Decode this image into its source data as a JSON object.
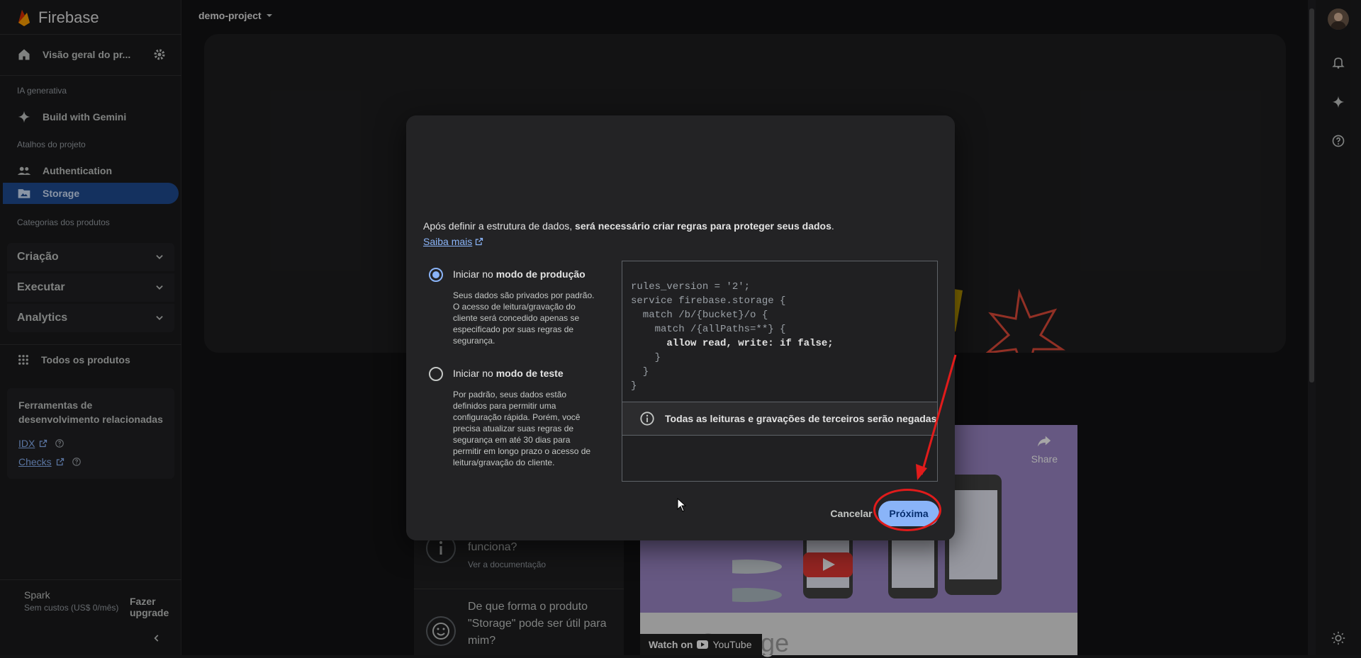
{
  "brand": {
    "name": "Firebase"
  },
  "project": {
    "name": "demo-project"
  },
  "sidebar": {
    "overview_label": "Visão geral do pr...",
    "section_ai": "IA generativa",
    "gemini_label": "Build with Gemini",
    "section_shortcuts": "Atalhos do projeto",
    "auth_label": "Authentication",
    "storage_label": "Storage",
    "section_categories": "Categorias dos produtos",
    "groups": [
      "Criação",
      "Executar",
      "Analytics"
    ],
    "all_products": "Todos os produtos",
    "devtools_title": "Ferramentas de desenvolvimento relacionadas",
    "devtools_links": [
      "IDX",
      "Checks"
    ],
    "plan_name": "Spark",
    "plan_cost": "Sem custos (US$ 0/mês)",
    "upgrade": "Fazer upgrade"
  },
  "background": {
    "card1_title": "funciona?",
    "card1_link": "Ver a documentação",
    "card2_title": "De que forma o produto \"Storage\" pode ser útil para mim?",
    "video_share": "Share",
    "video_watch": "Watch on",
    "video_brand": "YouTube",
    "video_title": "Storage"
  },
  "modal": {
    "intro_text": "Após definir a estrutura de dados, ",
    "intro_bold": "será necessário criar regras para proteger seus dados",
    "intro_end": ".",
    "learn_more": "Saiba mais",
    "option_prod": {
      "prefix": "Iniciar no ",
      "bold": "modo de produção",
      "selected": true,
      "desc": "Seus dados são privados por padrão. O acesso de leitura/gravação do cliente será concedido apenas se especificado por suas regras de segurança."
    },
    "option_test": {
      "prefix": "Iniciar no ",
      "bold": "modo de teste",
      "selected": false,
      "desc": "Por padrão, seus dados estão definidos para permitir uma configuração rápida. Porém, você precisa atualizar suas regras de segurança em até 30 dias para permitir em longo prazo o acesso de leitura/gravação do cliente."
    },
    "code_lines": [
      "rules_version = '2';",
      "",
      "service firebase.storage {",
      "  match /b/{bucket}/o {",
      "    match /{allPaths=**} {",
      "      allow read, write: if false;",
      "    }",
      "  }",
      "}"
    ],
    "notice": "Todas as leituras e gravações de terceiros serão negadas",
    "cancel": "Cancelar",
    "next": "Próxima"
  }
}
